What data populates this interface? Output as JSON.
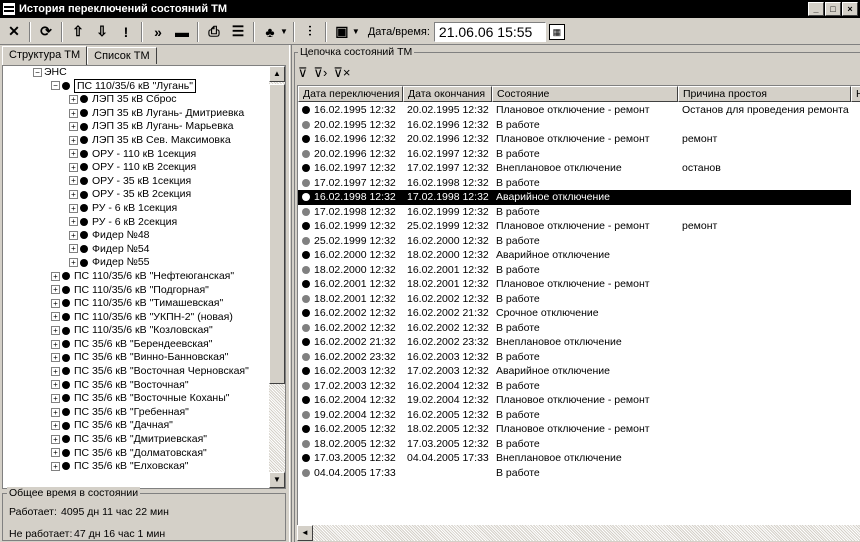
{
  "window": {
    "title": "История переключений состояний ТМ"
  },
  "toolbar": {
    "date_label": "Дата/время:",
    "date_value": "21.06.06 15:55",
    "buttons": [
      "close-icon",
      "refresh-icon",
      "up-icon",
      "down-icon",
      "alert-icon",
      "forward-icon",
      "minus-icon",
      "print-icon",
      "list-icon",
      "tree-icon",
      "filter-icon",
      "window-icon"
    ]
  },
  "tabs": [
    "Структура ТМ",
    "Список ТМ"
  ],
  "tree": {
    "root": "ЭНС",
    "selected": "ПС 110/35/6 кВ \"Лугань\"",
    "children": [
      "ЛЭП 35 кВ Сброс",
      "ЛЭП 35 кВ Лугань- Дмитриевка",
      "ЛЭП 35 кВ Лугань- Марьевка",
      "ЛЭП 35 кВ Сев. Максимовка",
      "ОРУ - 110 кВ 1секция",
      "ОРУ - 110 кВ 2секция",
      "ОРУ - 35 кВ 1секция",
      "ОРУ - 35 кВ 2секция",
      "РУ - 6 кВ 1секция",
      "РУ - 6 кВ 2секция",
      "Фидер №48",
      "Фидер №54",
      "Фидер №55"
    ],
    "siblings": [
      "ПС 110/35/6 кВ \"Нефтеюганская\"",
      "ПС 110/35/6 кВ \"Подгорная\"",
      "ПС 110/35/6 кВ \"Тимашевская\"",
      "ПС 110/35/6 кВ \"УКПН-2\" (новая)",
      "ПС 110/35/6 кВ \"Козловская\"",
      "ПС 35/6 кВ \"Берендеевская\"",
      "ПС 35/6 кВ \"Винно-Банновская\"",
      "ПС 35/6 кВ \"Восточная Черновская\"",
      "ПС 35/6 кВ \"Восточная\"",
      "ПС 35/6 кВ \"Восточные Коханы\"",
      "ПС 35/6 кВ \"Гребенная\"",
      "ПС 35/6 кВ \"Дачная\"",
      "ПС 35/6 кВ \"Дмитриевская\"",
      "ПС 35/6 кВ \"Долматовская\"",
      "ПС 35/6 кВ \"Елховская\""
    ]
  },
  "summary": {
    "title": "Общее время в состоянии",
    "working_label": "Работает:",
    "working_value": "4095 дн 11 час 22 мин",
    "notworking_label": "Не работает:",
    "notworking_value": "47 дн 16 час 1 мин"
  },
  "chain": {
    "title": "Цепочка состояний ТМ",
    "columns": [
      "Дата переключения",
      "Дата окончания",
      "Состояние",
      "Причина простоя",
      "Н"
    ],
    "selected_index": 6,
    "rows": [
      {
        "on": true,
        "start": "16.02.1995 12:32",
        "end": "20.02.1995 12:32",
        "state": "Плановое отключение - ремонт",
        "reason": "Останов для проведения ремонта"
      },
      {
        "on": false,
        "start": "20.02.1995 12:32",
        "end": "16.02.1996 12:32",
        "state": "В работе",
        "reason": ""
      },
      {
        "on": true,
        "start": "16.02.1996 12:32",
        "end": "20.02.1996 12:32",
        "state": "Плановое отключение - ремонт",
        "reason": "ремонт"
      },
      {
        "on": false,
        "start": "20.02.1996 12:32",
        "end": "16.02.1997 12:32",
        "state": "В работе",
        "reason": ""
      },
      {
        "on": true,
        "start": "16.02.1997 12:32",
        "end": "17.02.1997 12:32",
        "state": "Внеплановое отключение",
        "reason": "останов"
      },
      {
        "on": false,
        "start": "17.02.1997 12:32",
        "end": "16.02.1998 12:32",
        "state": "В работе",
        "reason": ""
      },
      {
        "on": true,
        "start": "16.02.1998 12:32",
        "end": "17.02.1998 12:32",
        "state": "Аварийное отключение",
        "reason": ""
      },
      {
        "on": false,
        "start": "17.02.1998 12:32",
        "end": "16.02.1999 12:32",
        "state": "В работе",
        "reason": ""
      },
      {
        "on": true,
        "start": "16.02.1999 12:32",
        "end": "25.02.1999 12:32",
        "state": "Плановое отключение - ремонт",
        "reason": "ремонт"
      },
      {
        "on": false,
        "start": "25.02.1999 12:32",
        "end": "16.02.2000 12:32",
        "state": "В работе",
        "reason": ""
      },
      {
        "on": true,
        "start": "16.02.2000 12:32",
        "end": "18.02.2000 12:32",
        "state": "Аварийное отключение",
        "reason": ""
      },
      {
        "on": false,
        "start": "18.02.2000 12:32",
        "end": "16.02.2001 12:32",
        "state": "В работе",
        "reason": ""
      },
      {
        "on": true,
        "start": "16.02.2001 12:32",
        "end": "18.02.2001 12:32",
        "state": "Плановое отключение - ремонт",
        "reason": ""
      },
      {
        "on": false,
        "start": "18.02.2001 12:32",
        "end": "16.02.2002 12:32",
        "state": "В работе",
        "reason": ""
      },
      {
        "on": true,
        "start": "16.02.2002 12:32",
        "end": "16.02.2002 21:32",
        "state": "Срочное отключение",
        "reason": ""
      },
      {
        "on": false,
        "start": "16.02.2002 12:32",
        "end": "16.02.2002 12:32",
        "state": "В работе",
        "reason": ""
      },
      {
        "on": true,
        "start": "16.02.2002 21:32",
        "end": "16.02.2002 23:32",
        "state": "Внеплановое отключение",
        "reason": ""
      },
      {
        "on": false,
        "start": "16.02.2002 23:32",
        "end": "16.02.2003 12:32",
        "state": "В работе",
        "reason": ""
      },
      {
        "on": true,
        "start": "16.02.2003 12:32",
        "end": "17.02.2003 12:32",
        "state": "Аварийное отключение",
        "reason": ""
      },
      {
        "on": false,
        "start": "17.02.2003 12:32",
        "end": "16.02.2004 12:32",
        "state": "В работе",
        "reason": ""
      },
      {
        "on": true,
        "start": "16.02.2004 12:32",
        "end": "19.02.2004 12:32",
        "state": "Плановое отключение - ремонт",
        "reason": ""
      },
      {
        "on": false,
        "start": "19.02.2004 12:32",
        "end": "16.02.2005 12:32",
        "state": "В работе",
        "reason": ""
      },
      {
        "on": true,
        "start": "16.02.2005 12:32",
        "end": "18.02.2005 12:32",
        "state": "Плановое отключение - ремонт",
        "reason": ""
      },
      {
        "on": false,
        "start": "18.02.2005 12:32",
        "end": "17.03.2005 12:32",
        "state": "В работе",
        "reason": ""
      },
      {
        "on": true,
        "start": "17.03.2005 12:32",
        "end": "04.04.2005 17:33",
        "state": "Внеплановое отключение",
        "reason": ""
      },
      {
        "on": false,
        "start": "04.04.2005 17:33",
        "end": "",
        "state": "В работе",
        "reason": ""
      }
    ]
  },
  "colors": {
    "on_dot": "#000000",
    "off_dot": "#808080",
    "selection": "#000000"
  }
}
